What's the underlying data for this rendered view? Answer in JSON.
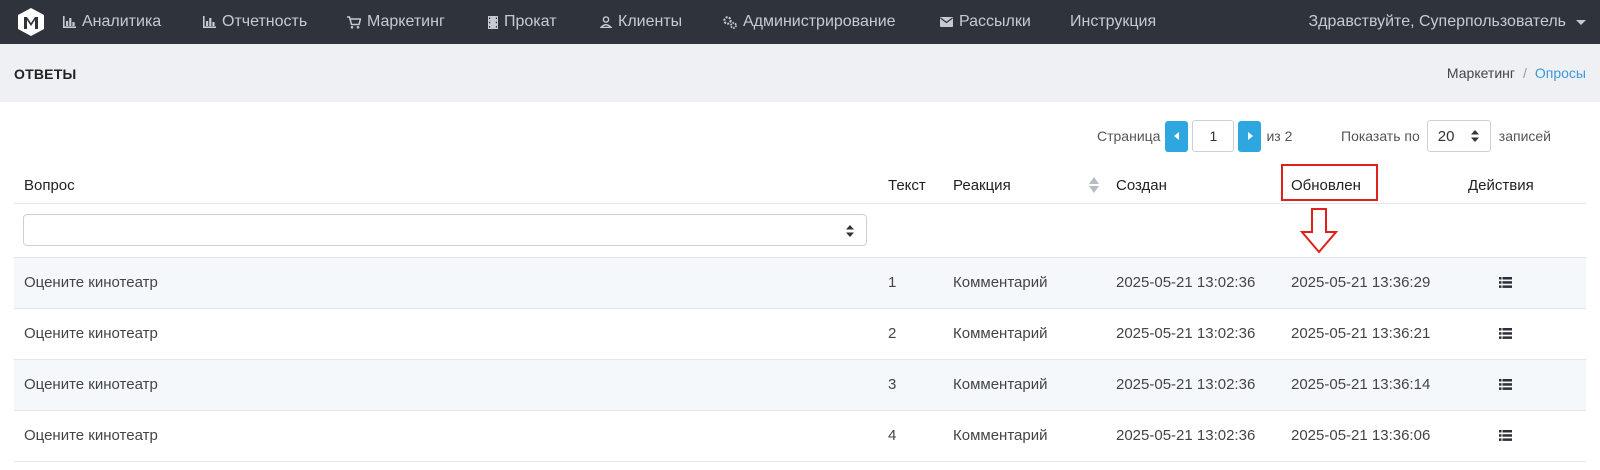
{
  "nav": {
    "items": [
      {
        "label": "Аналитика",
        "icon": "bar-chart-icon"
      },
      {
        "label": "Отчетность",
        "icon": "bar-chart-icon"
      },
      {
        "label": "Маркетинг",
        "icon": "cart-icon"
      },
      {
        "label": "Прокат",
        "icon": "film-icon"
      },
      {
        "label": "Клиенты",
        "icon": "user-icon"
      },
      {
        "label": "Администрирование",
        "icon": "gears-icon"
      },
      {
        "label": "Рассылки",
        "icon": "envelope-icon"
      },
      {
        "label": "Инструкция",
        "icon": ""
      }
    ],
    "user_greeting": "Здравствуйте, Суперпользователь"
  },
  "header": {
    "title": "ОТВЕТЫ",
    "breadcrumb": {
      "parent": "Маркетинг",
      "separator": "/",
      "current": "Опросы"
    }
  },
  "pagination": {
    "page_label": "Страница",
    "current_page": "1",
    "of_label": "из 2",
    "show_label": "Показать по",
    "page_size": "20",
    "records_label": "записей"
  },
  "table": {
    "columns": [
      "Вопрос",
      "Текст",
      "Реакция",
      "Создан",
      "Обновлен",
      "Действия"
    ],
    "rows": [
      {
        "question": "Оцените кинотеатр",
        "text": "1",
        "reaction": "Комментарий",
        "created": "2025-05-21 13:02:36",
        "updated": "2025-05-21 13:36:29"
      },
      {
        "question": "Оцените кинотеатр",
        "text": "2",
        "reaction": "Комментарий",
        "created": "2025-05-21 13:02:36",
        "updated": "2025-05-21 13:36:21"
      },
      {
        "question": "Оцените кинотеатр",
        "text": "3",
        "reaction": "Комментарий",
        "created": "2025-05-21 13:02:36",
        "updated": "2025-05-21 13:36:14"
      },
      {
        "question": "Оцените кинотеатр",
        "text": "4",
        "reaction": "Комментарий",
        "created": "2025-05-21 13:02:36",
        "updated": "2025-05-21 13:36:06"
      }
    ]
  },
  "colors": {
    "navbar": "#2f343c",
    "accent": "#2ea7e0",
    "annotation": "#e0201c"
  }
}
